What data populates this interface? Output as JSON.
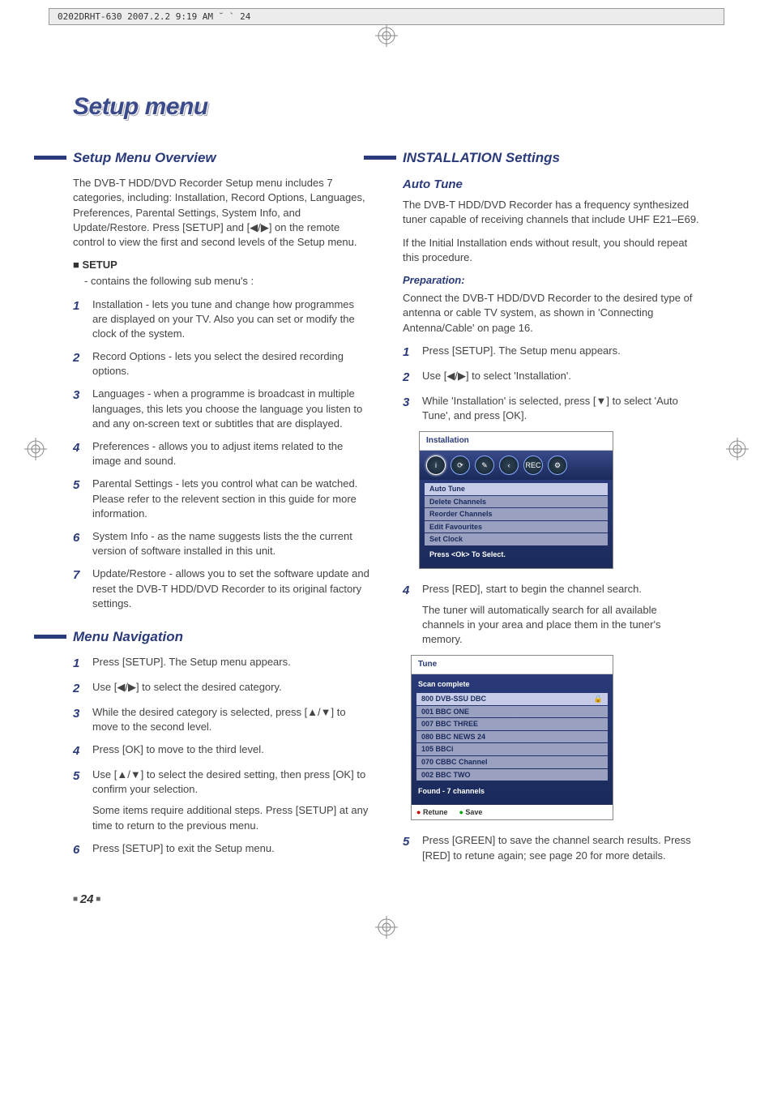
{
  "header_meta": "0202DRHT-630  2007.2.2 9:19 AM  ˘ ` 24",
  "page_title": "Setup menu",
  "left": {
    "h_overview": "Setup Menu Overview",
    "intro": "The DVB-T HDD/DVD Recorder Setup menu includes 7 categories, including: Installation, Record Options, Languages, Preferences, Parental Settings, System Info, and Update/Restore. Press [SETUP] and [◀/▶] on the remote control to view the first and second levels of the Setup menu.",
    "setup_label": "SETUP",
    "setup_note": "- contains the following sub menu's :",
    "items": [
      "Installation - lets you tune and change how programmes are displayed on your TV. Also you can set or modify the clock of the system.",
      "Record Options - lets you select the desired recording options.",
      "Languages - when a programme is broadcast in multiple languages, this lets you choose the language you listen to and any on-screen text or subtitles that are displayed.",
      "Preferences - allows you to adjust items related to the image and sound.",
      "Parental Settings - lets you control what can be watched. Please refer to the relevent section in this guide for more information.",
      "System Info - as the name suggests lists the the current version of software installed in this unit.",
      "Update/Restore - allows you to set the software update and reset the DVB-T HDD/DVD Recorder to its original factory settings."
    ],
    "h_nav": "Menu Navigation",
    "nav": [
      "Press [SETUP]. The Setup menu appears.",
      "Use [◀/▶] to select the desired category.",
      "While the desired category is selected, press [▲/▼] to move to the second level.",
      "Press [OK] to move to the third level.",
      "Use [▲/▼] to select the desired setting, then press [OK] to confirm your selection.",
      "Press [SETUP] to exit the Setup menu."
    ],
    "nav5_extra": "Some items require additional steps. Press [SETUP] at any time to return to the previous menu."
  },
  "right": {
    "h_install": "INSTALLATION Settings",
    "h_autotune": "Auto Tune",
    "autotune_p1": "The DVB-T HDD/DVD Recorder has a frequency synthesized tuner capable of receiving channels that include UHF E21–E69.",
    "autotune_p2": "If the Initial Installation ends without result, you should repeat this procedure.",
    "h_prep": "Preparation:",
    "prep_p": "Connect the DVB-T HDD/DVD Recorder to the desired type of antenna or cable TV system, as shown in 'Connecting Antenna/Cable' on page 16.",
    "steps_a": [
      "Press [SETUP]. The Setup menu appears.",
      "Use [◀/▶] to select 'Installation'.",
      "While 'Installation' is selected, press [▼] to select 'Auto Tune', and press [OK]."
    ],
    "osd1": {
      "title": "Installation",
      "icons": [
        "i",
        "⟳",
        "✎",
        "‹",
        "REC",
        "⚙"
      ],
      "rows": [
        "Auto Tune",
        "Delete Channels",
        "Reorder Channels",
        "Edit Favourites",
        "Set Clock"
      ],
      "footer": "Press <Ok> To Select."
    },
    "step4": "Press [RED], start to begin the channel search.",
    "step4_p": "The tuner will automatically search for all available channels in your area and place them in the tuner's memory.",
    "osd2": {
      "title": "Tune",
      "status": "Scan complete",
      "rows": [
        {
          "ch": "800 DVB-SSU DBC",
          "lock": "🔒"
        },
        {
          "ch": "001 BBC ONE",
          "lock": ""
        },
        {
          "ch": "007 BBC THREE",
          "lock": ""
        },
        {
          "ch": "080 BBC NEWS 24",
          "lock": ""
        },
        {
          "ch": "105 BBCi",
          "lock": ""
        },
        {
          "ch": "070 CBBC Channel",
          "lock": ""
        },
        {
          "ch": "002 BBC TWO",
          "lock": ""
        }
      ],
      "found": "Found - 7 channels",
      "btn_retune": "Retune",
      "btn_save": "Save"
    },
    "step5": "Press [GREEN] to save the channel search results. Press [RED] to retune again; see page 20 for more details."
  },
  "page_number": "24"
}
